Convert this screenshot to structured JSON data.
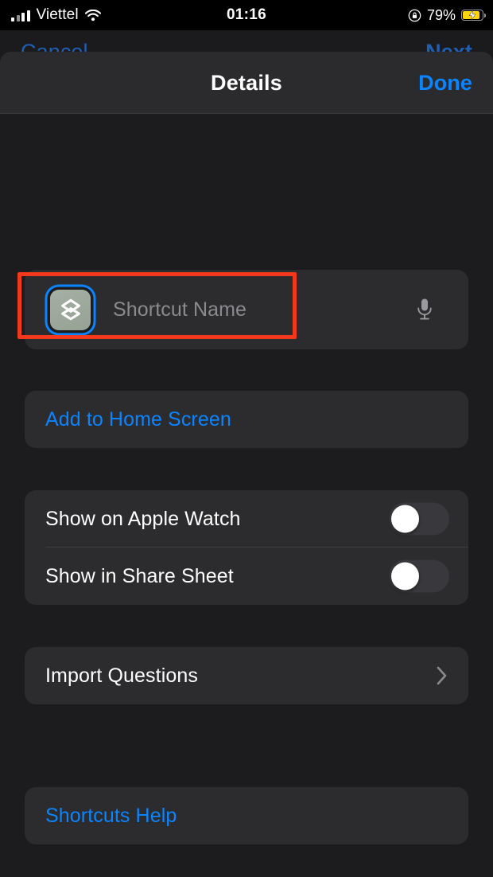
{
  "status_bar": {
    "carrier": "Viettel",
    "time": "01:16",
    "battery_percent": "79%",
    "battery_level": 79,
    "charging": true,
    "wifi_icon": "wifi-icon",
    "signal_icon": "cellular-signal-icon",
    "rotation_lock_icon": "rotation-lock-icon",
    "battery_icon": "battery-charging-icon"
  },
  "background_screen": {
    "cancel_label": "Cancel",
    "next_label": "Next"
  },
  "sheet": {
    "title": "Details",
    "done_label": "Done"
  },
  "name_field": {
    "placeholder": "Shortcut Name",
    "value": "",
    "icon_name": "shortcut-glyph-icon",
    "icon_background": "#9da89b",
    "icon_selected_color": "#0a84ff",
    "mic_icon": "microphone-icon"
  },
  "actions": {
    "add_to_home_screen": "Add to Home Screen"
  },
  "toggles": [
    {
      "label": "Show on Apple Watch",
      "value": false
    },
    {
      "label": "Show in Share Sheet",
      "value": false
    }
  ],
  "navigation": {
    "import_questions": "Import Questions",
    "chevron_icon": "chevron-right-icon"
  },
  "help": {
    "shortcuts_help": "Shortcuts Help"
  },
  "annotation": {
    "target": "Add to Home Screen",
    "color": "#f2391c"
  },
  "colors": {
    "accent_blue": "#0a84ff",
    "sheet_background": "#1c1c1e",
    "card_background": "#2c2c2e",
    "header_background": "#2b2b2d",
    "toggle_off_track": "#39393d",
    "battery_yellow": "#ffd60a"
  }
}
